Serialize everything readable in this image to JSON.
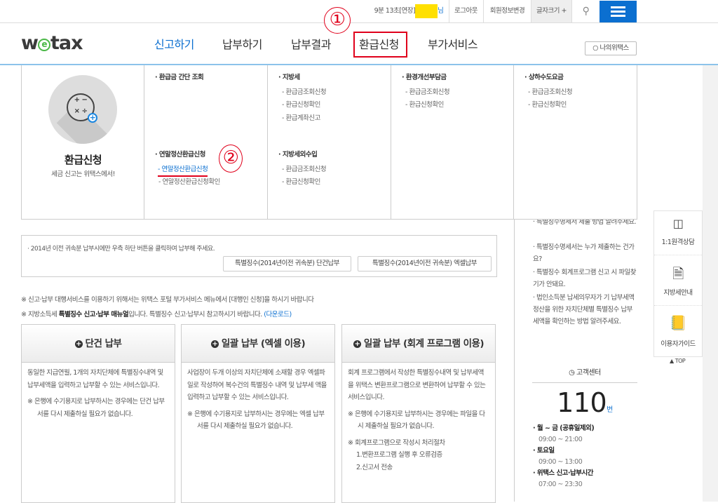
{
  "topbar": {
    "timer": "9분 13초[연장]",
    "user_suffix": "님",
    "logout": "로그아웃",
    "member_edit": "회원정보변경",
    "font_size": "글자크기 +"
  },
  "header": {
    "logo": "wetax",
    "nav": [
      "신고하기",
      "납부하기",
      "납부결과",
      "환급신청",
      "부가서비스"
    ],
    "my_wetax": "나의위택스",
    "annotation_1": "①",
    "annotation_2": "②"
  },
  "mega": {
    "title": "환급신청",
    "subtitle": "세금 신고는 위택스에서!",
    "columns": [
      {
        "groups": [
          {
            "heading": "· 환급금 간단 조회",
            "items": []
          },
          {
            "heading": "· 연말정산환급신청",
            "items": [
              "- 연말정산환급신청",
              "- 연말정산환급신청확인"
            ]
          }
        ]
      },
      {
        "groups": [
          {
            "heading": "· 지방세",
            "items": [
              "- 환급금조회신청",
              "- 환급신청확인",
              "- 환급계좌신고"
            ]
          },
          {
            "heading": "· 지방세외수입",
            "items": [
              "- 환급금조회신청",
              "- 환급신청확인"
            ]
          }
        ]
      },
      {
        "groups": [
          {
            "heading": "· 환경개선부담금",
            "items": [
              "- 환급금조회신청",
              "- 환급신청확인"
            ]
          }
        ]
      },
      {
        "groups": [
          {
            "heading": "· 상하수도요금",
            "items": [
              "- 환급금조회신청",
              "- 환급신청확인"
            ]
          }
        ]
      }
    ]
  },
  "notice": {
    "text": "· 2014년 이전 귀속분 납부시에만 우측 하단 버튼을 클릭하여 납부해 주세요.",
    "btn_single": "특별징수(2014년이전 귀속분) 단건납부",
    "btn_excel": "특별징수(2014년이전 귀속분) 엑셀납부"
  },
  "notes": {
    "line1": "※ 신고·납부 대행서비스를 이용하기 위해서는 위택스 포털 부가서비스 메뉴에서 [대행인 신청]을 하시기 바랍니다",
    "line2_a": "※ 지방소득세 ",
    "line2_b": "특별징수 신고·납부 매뉴얼",
    "line2_c": "입니다. 특별징수 신고·납부시 참고하시기 바랍니다. ",
    "line2_link": "(다운로드)"
  },
  "cards": [
    {
      "title": "단건 납부",
      "desc": "동일한 지급연월, 1개의 자치단체에 특별징수내역 및 납부세액을 입력하고 납부할 수 있는 서비스입니다.",
      "note": "※ 은행에 수기용지로 납부하시는 경우에는 단건 납부서를 다시 제출하실 필요가 없습니다."
    },
    {
      "title": "일괄 납부 (엑셀 이용)",
      "desc": "사업장이 두개 이상의 자치단체에 소재할 경우 엑셀파일로 작성하여 복수건의 특별징수 내역 및 납부세 액을 입력하고 납부할 수 있는 서비스입니다.",
      "note": "※ 은행에 수기용지로 납부하시는 경우에는 엑셀 납부서를 다시 제출하실 필요가 없습니다."
    },
    {
      "title": "일괄 납부 (회계 프로그램 이용)",
      "desc": "회계 프로그램에서 작성한 특별징수내역 및 납부세액을 위택스 변환프로그램으로 변환하여 납부할 수 있는 서비스입니다.",
      "note": "※ 은행에 수기용지로 납부하시는 경우에는 파일을 다시 제출하실 필요가 없습니다.",
      "note2": "※ 회계프로그램으로 작성시 처리절차",
      "steps": [
        "1.변환프로그램 실행 후 오류검증",
        "2.신고서 전송"
      ]
    }
  ],
  "faq": [
    "· 특별징수명세서 제출 방법 알려주세요.",
    "· 특별징수명세서는 누가 제출하는 건가요?",
    "· 특별징수 회계프로그램 신고 시 파일찾기가 안돼요.",
    "· 법인소득분 납세의무자가 기 납부세액 정산을 위한 자치단체별 특별징수 납부세액을 확인하는 방법 알려주세요."
  ],
  "center": {
    "title": "고객센터",
    "number": "110",
    "unit": "번",
    "hours": [
      {
        "label": "· 월 ~ 금 (공휴일제외)",
        "time": "09:00 ~ 21:00"
      },
      {
        "label": "· 토요일",
        "time": "09:00 ~ 13:00"
      },
      {
        "label": "· 위택스 신고·납부시간",
        "time": "07:00 ~ 23:30"
      }
    ]
  },
  "side": {
    "items": [
      "1:1원격상담",
      "지방세안내",
      "이용자가이드"
    ],
    "top": "TOP"
  },
  "colors": {
    "accent": "#0b6fd0",
    "annotation": "#e0001b",
    "logo_green": "#4cb848"
  }
}
